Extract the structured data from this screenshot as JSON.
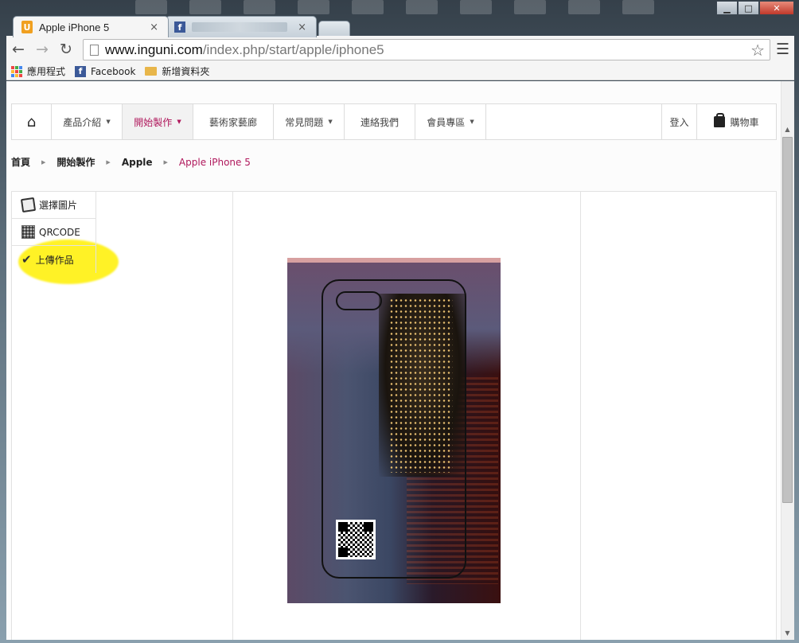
{
  "browser": {
    "tabs": [
      {
        "title": "Apple iPhone 5",
        "favicon": "inguni-u-icon",
        "active": true
      },
      {
        "title": "",
        "favicon": "facebook-icon",
        "active": false
      }
    ],
    "tab_close_glyph": "×",
    "url_host": "www.inguni.com",
    "url_path": "/index.php/start/apple/iphone5",
    "bookmarks": [
      {
        "label": "應用程式",
        "icon": "apps-grid-icon"
      },
      {
        "label": "Facebook",
        "icon": "facebook-icon"
      },
      {
        "label": "新增資料夾",
        "icon": "folder-icon"
      }
    ]
  },
  "site": {
    "nav": [
      {
        "label": "",
        "icon": "home-icon"
      },
      {
        "label": "產品介紹",
        "has_caret": true
      },
      {
        "label": "開始製作",
        "has_caret": true,
        "active": true
      },
      {
        "label": "藝術家藝廊",
        "has_caret": false
      },
      {
        "label": "常見問題",
        "has_caret": true
      },
      {
        "label": "連絡我們",
        "has_caret": false
      },
      {
        "label": "會員專區",
        "has_caret": true
      }
    ],
    "nav_right": {
      "login": "登入",
      "cart": "購物車"
    },
    "breadcrumb": [
      "首頁",
      "開始製作",
      "Apple",
      "Apple iPhone 5"
    ],
    "side_menu": [
      {
        "label": "選擇圖片",
        "icon": "picture-icon"
      },
      {
        "label": "QRCODE",
        "icon": "qrcode-icon"
      },
      {
        "label": "上傳作品",
        "icon": "checkmark-icon",
        "highlighted": true
      }
    ],
    "accent_color": "#b0185c"
  }
}
